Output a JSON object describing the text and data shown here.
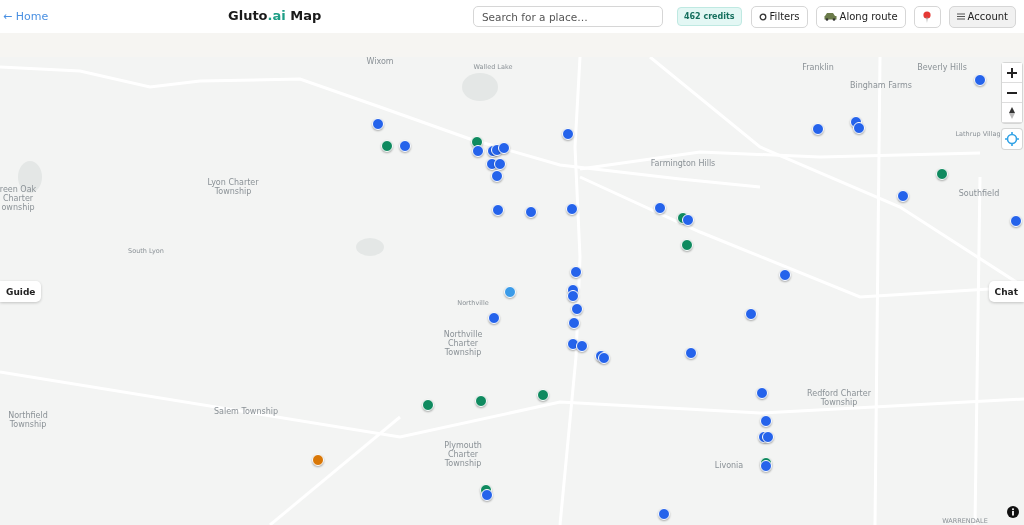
{
  "header": {
    "back_link": "← Home",
    "title": {
      "brand": "Gluto",
      "accent": ".ai",
      "suffix": " Map"
    },
    "search": {
      "placeholder": "Search for a place…"
    },
    "credits": "462 credits",
    "buttons": [
      {
        "kind": "filter",
        "label": "Filters"
      },
      {
        "kind": "route",
        "label": "Along route"
      },
      {
        "kind": "pin"
      },
      {
        "kind": "account",
        "label": "Account"
      }
    ]
  },
  "map": {
    "labels": [
      {
        "text": "Wixom",
        "kind": "city"
      },
      {
        "text": "Walled Lake",
        "kind": "small"
      },
      {
        "text": "Franklin",
        "kind": "city"
      },
      {
        "text": "Beverly Hills",
        "kind": "city"
      },
      {
        "text": "Bingham Farms",
        "kind": "city"
      },
      {
        "text": "Lathrup Villag",
        "kind": "small"
      },
      {
        "text": "Farmington Hills",
        "kind": "city"
      },
      {
        "text": "Southfield",
        "kind": "city"
      },
      {
        "text": "Lyon Charter\nTownship",
        "kind": "city"
      },
      {
        "text": "reen Oak\nCharter\nownship",
        "kind": "city"
      },
      {
        "text": "South Lyon",
        "kind": "small"
      },
      {
        "text": "Northville",
        "kind": "small"
      },
      {
        "text": "Northville\nCharter\nTownship",
        "kind": "city"
      },
      {
        "text": "Northfield\nTownship",
        "kind": "city"
      },
      {
        "text": "Salem Township",
        "kind": "city"
      },
      {
        "text": "Plymouth\nCharter\nTownship",
        "kind": "city"
      },
      {
        "text": "Livonia",
        "kind": "city"
      },
      {
        "text": "Redford Charter\nTownship",
        "kind": "city"
      },
      {
        "text": "WARRENDALE",
        "kind": "small"
      }
    ],
    "markers": [
      {
        "color": "#2563eb"
      },
      {
        "color": "#0f8a5f"
      },
      {
        "color": "#2563eb"
      },
      {
        "color": "#0f8a5f"
      },
      {
        "color": "#2563eb"
      },
      {
        "color": "#2563eb"
      },
      {
        "color": "#2563eb"
      },
      {
        "color": "#2563eb"
      },
      {
        "color": "#2563eb"
      },
      {
        "color": "#2563eb"
      },
      {
        "color": "#2563eb"
      },
      {
        "color": "#2563eb"
      },
      {
        "color": "#2563eb"
      },
      {
        "color": "#2563eb"
      },
      {
        "color": "#2563eb"
      },
      {
        "color": "#2563eb"
      },
      {
        "color": "#0f8a5f"
      },
      {
        "color": "#2563eb"
      },
      {
        "color": "#0f8a5f"
      },
      {
        "color": "#2563eb"
      },
      {
        "color": "#2563eb"
      },
      {
        "color": "#2563eb"
      },
      {
        "color": "#2563eb"
      },
      {
        "color": "#0f8a5f"
      },
      {
        "color": "#2563eb"
      },
      {
        "color": "#2563eb"
      },
      {
        "color": "#2563eb"
      },
      {
        "color": "#2563eb"
      },
      {
        "color": "#2563eb"
      },
      {
        "color": "#3b9be8"
      },
      {
        "color": "#2563eb"
      },
      {
        "color": "#2563eb"
      },
      {
        "color": "#2563eb"
      },
      {
        "color": "#2563eb"
      },
      {
        "color": "#2563eb"
      },
      {
        "color": "#2563eb"
      },
      {
        "color": "#2563eb"
      },
      {
        "color": "#2563eb"
      },
      {
        "color": "#2563eb"
      },
      {
        "color": "#2563eb"
      },
      {
        "color": "#2563eb"
      },
      {
        "color": "#2563eb"
      },
      {
        "color": "#2563eb"
      },
      {
        "color": "#2563eb"
      },
      {
        "color": "#0f8a5f"
      },
      {
        "color": "#2563eb"
      },
      {
        "color": "#0f8a5f"
      },
      {
        "color": "#0f8a5f"
      },
      {
        "color": "#0f8a5f"
      },
      {
        "color": "#d97706"
      },
      {
        "color": "#0f8a5f"
      },
      {
        "color": "#2563eb"
      },
      {
        "color": "#2563eb"
      }
    ],
    "side_buttons": [
      {
        "kind": "left",
        "label": "Guide"
      },
      {
        "kind": "right",
        "label": "Chat"
      }
    ]
  }
}
